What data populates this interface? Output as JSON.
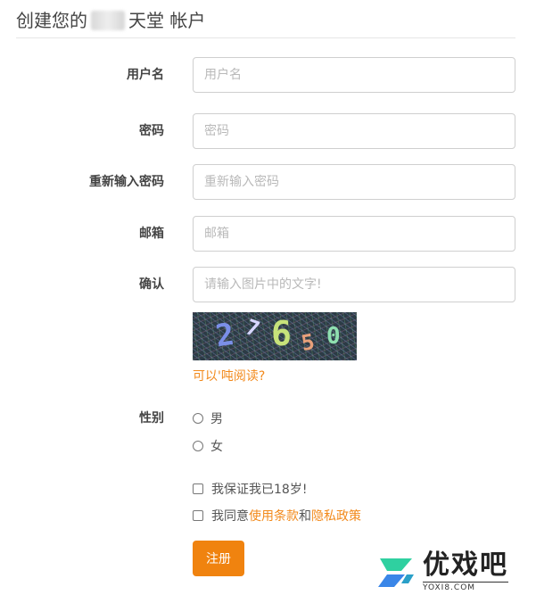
{
  "header": {
    "title_prefix": "创建您的",
    "title_suffix": "天堂 帐户"
  },
  "form": {
    "username": {
      "label": "用户名",
      "placeholder": "用户名"
    },
    "password": {
      "label": "密码",
      "placeholder": "密码"
    },
    "confirm_password": {
      "label": "重新输入密码",
      "placeholder": "重新输入密码"
    },
    "email": {
      "label": "邮箱",
      "placeholder": "邮箱"
    },
    "captcha": {
      "label": "确认",
      "placeholder": "请输入图片中的文字!"
    },
    "captcha_image": {
      "digits": [
        {
          "char": "2",
          "color": "#7b8fe8"
        },
        {
          "char": "7",
          "color": "#d7d7ff"
        },
        {
          "char": "6",
          "color": "#c7e27a"
        },
        {
          "char": "5",
          "color": "#e8a07a"
        },
        {
          "char": "0",
          "color": "#8fe0b0"
        }
      ]
    },
    "captcha_help": "可以'吨阅读?",
    "gender": {
      "label": "性别",
      "options": [
        "男",
        "女"
      ]
    },
    "age_check": "我保证我已18岁!",
    "agree": {
      "prefix": "我同意",
      "terms": "使用条款",
      "and": "和",
      "privacy": "隐私政策"
    },
    "submit": "注册"
  },
  "watermark": {
    "name": "优戏吧",
    "domain": "YOXI8.COM"
  },
  "colors": {
    "accent": "#f0830f",
    "link": "#f28a1c"
  }
}
